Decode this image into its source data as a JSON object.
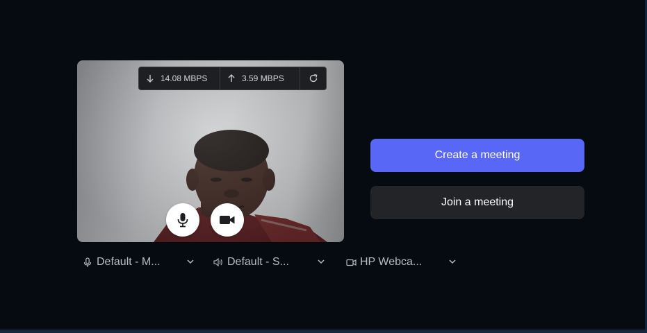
{
  "network": {
    "download": "14.08 MBPS",
    "upload": "3.59 MBPS"
  },
  "actions": {
    "create": "Create a meeting",
    "join": "Join a meeting"
  },
  "devices": {
    "microphone": "Default - M...",
    "speaker": "Default - S...",
    "camera": "HP Webca..."
  },
  "icons": {
    "download": "arrow-down-icon",
    "upload": "arrow-up-icon",
    "refresh": "refresh-icon",
    "mic": "microphone-icon",
    "camera": "video-camera-icon",
    "speaker": "speaker-icon",
    "chevron": "chevron-down-icon"
  },
  "colors": {
    "background": "#060b12",
    "primary": "#5867f5",
    "secondary": "#222428"
  }
}
